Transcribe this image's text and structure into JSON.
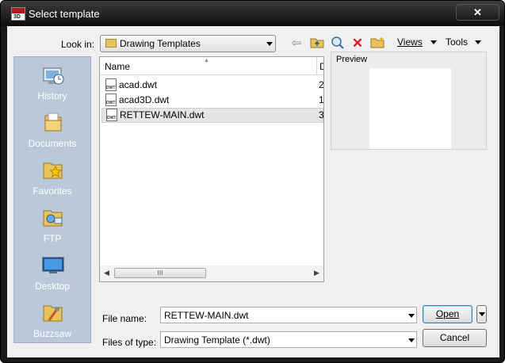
{
  "window": {
    "title": "Select template",
    "close_label": "✕",
    "app_icon_text": "3D"
  },
  "toolbar": {
    "look_in_label": "Look in:",
    "look_in_value": "Drawing Templates",
    "views_label": "Views",
    "tools_label": "Tools",
    "icons": [
      "back-icon",
      "up-folder-icon",
      "search-web-icon",
      "delete-icon",
      "new-folder-icon"
    ]
  },
  "places": [
    {
      "label": "History",
      "icon": "history-icon"
    },
    {
      "label": "Documents",
      "icon": "documents-icon"
    },
    {
      "label": "Favorites",
      "icon": "favorites-icon"
    },
    {
      "label": "FTP",
      "icon": "ftp-icon"
    },
    {
      "label": "Desktop",
      "icon": "desktop-icon"
    },
    {
      "label": "Buzzsaw",
      "icon": "buzzsaw-icon"
    }
  ],
  "file_list": {
    "columns": [
      "Name",
      "D"
    ],
    "rows": [
      {
        "name": "acad.dwt",
        "col2": "2",
        "icon_text": "DWT",
        "selected": false
      },
      {
        "name": "acad3D.dwt",
        "col2": "1",
        "icon_text": "DWT",
        "selected": false
      },
      {
        "name": "RETTEW-MAIN.dwt",
        "col2": "3",
        "icon_text": "DWT",
        "selected": true
      }
    ],
    "scroll_thumb_label": "III"
  },
  "preview": {
    "label": "Preview"
  },
  "form": {
    "file_name_label": "File name:",
    "file_name_value": "RETTEW-MAIN.dwt",
    "file_type_label": "Files of type:",
    "file_type_value": "Drawing Template (*.dwt)",
    "open_label": "Open",
    "cancel_label": "Cancel"
  },
  "colors": {
    "places_bg": "#b9c9da",
    "titlebar": "#1a1a1a"
  }
}
